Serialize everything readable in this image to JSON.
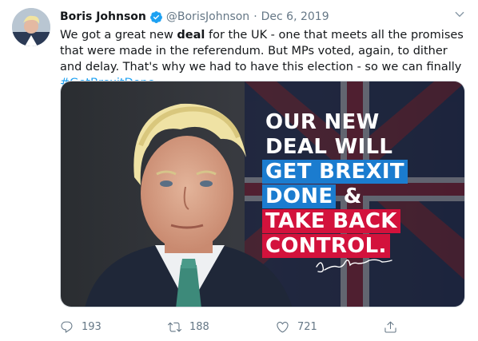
{
  "tweet": {
    "display_name": "Boris Johnson",
    "handle": "@BorisJohnson",
    "separator": "·",
    "date": "Dec 6, 2019",
    "text_parts": {
      "p1": "We got a great new ",
      "bold": "deal",
      "p2": " for the UK - one that meets all the promises that were made in the referendum. But MPs voted, again, to dither and delay. That's why we had to have this election - so we can finally ",
      "hashtag": "#GetBrexitDone"
    }
  },
  "media": {
    "headline_line1": "OUR NEW",
    "headline_line2": "DEAL WILL",
    "headline_line3": "GET BREXIT",
    "headline_line4_box": "DONE",
    "headline_line4_rest": " &",
    "headline_line5": "TAKE BACK",
    "headline_line6": "CONTROL."
  },
  "actions": {
    "replies": "193",
    "retweets": "188",
    "likes": "721"
  },
  "colors": {
    "accent": "#1da1f2",
    "muted": "#657786",
    "headline_blue": "#1b7ccf",
    "headline_red": "#d3123c"
  },
  "icons": [
    "verified-badge-icon",
    "chevron-down-icon",
    "reply-icon",
    "retweet-icon",
    "like-icon",
    "share-icon"
  ]
}
